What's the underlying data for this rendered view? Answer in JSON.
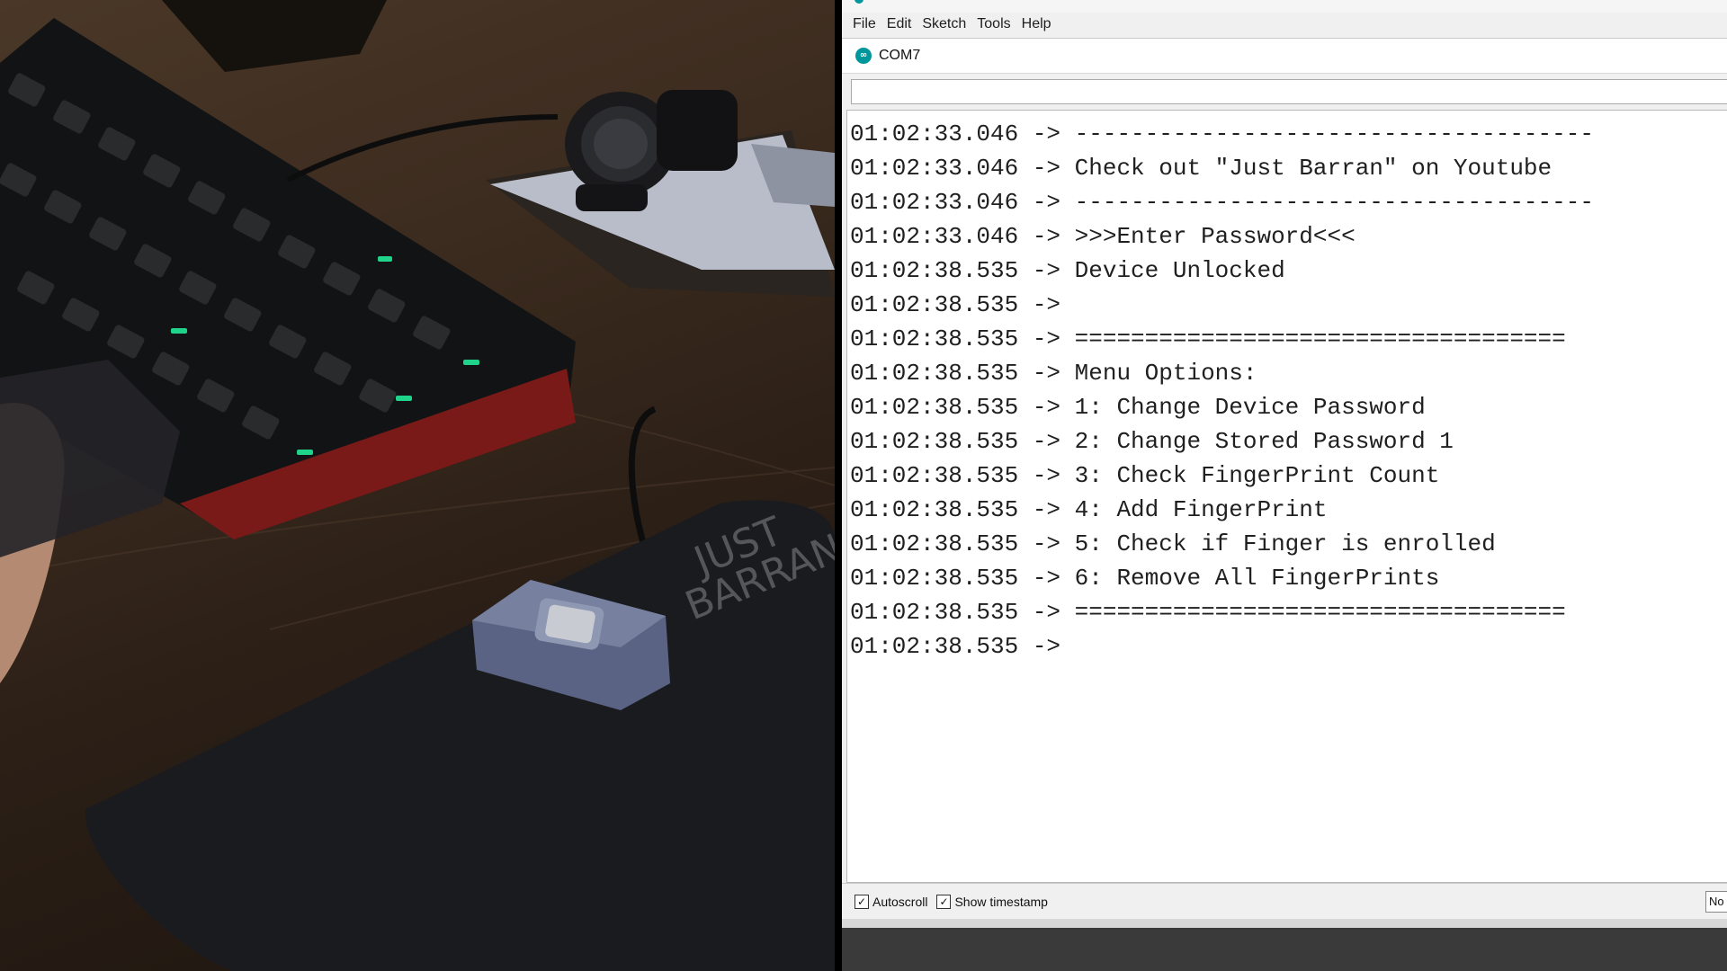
{
  "menu": [
    "File",
    "Edit",
    "Sketch",
    "Tools",
    "Help"
  ],
  "window": {
    "port_title": "COM7",
    "app_icon": "arduino-logo-icon"
  },
  "send": {
    "value": ""
  },
  "output_lines": [
    "01:02:33.046 -> -------------------------------------",
    "01:02:33.046 -> Check out \"Just Barran\" on Youtube",
    "01:02:33.046 -> -------------------------------------",
    "01:02:33.046 -> >>>Enter Password<<<",
    "01:02:38.535 -> Device Unlocked",
    "01:02:38.535 -> ",
    "01:02:38.535 -> ===================================",
    "01:02:38.535 -> Menu Options:",
    "01:02:38.535 -> 1: Change Device Password",
    "01:02:38.535 -> 2: Change Stored Password 1",
    "01:02:38.535 -> 3: Check FingerPrint Count",
    "01:02:38.535 -> 4: Add FingerPrint",
    "01:02:38.535 -> 5: Check if Finger is enrolled",
    "01:02:38.535 -> 6: Remove All FingerPrints",
    "01:02:38.535 -> ===================================",
    "01:02:38.535 -> "
  ],
  "status": {
    "autoscroll_label": "Autoscroll",
    "autoscroll_checked": true,
    "timestamp_label": "Show timestamp",
    "timestamp_checked": true,
    "line_ending": "No"
  },
  "colors": {
    "accent": "#00979c"
  }
}
